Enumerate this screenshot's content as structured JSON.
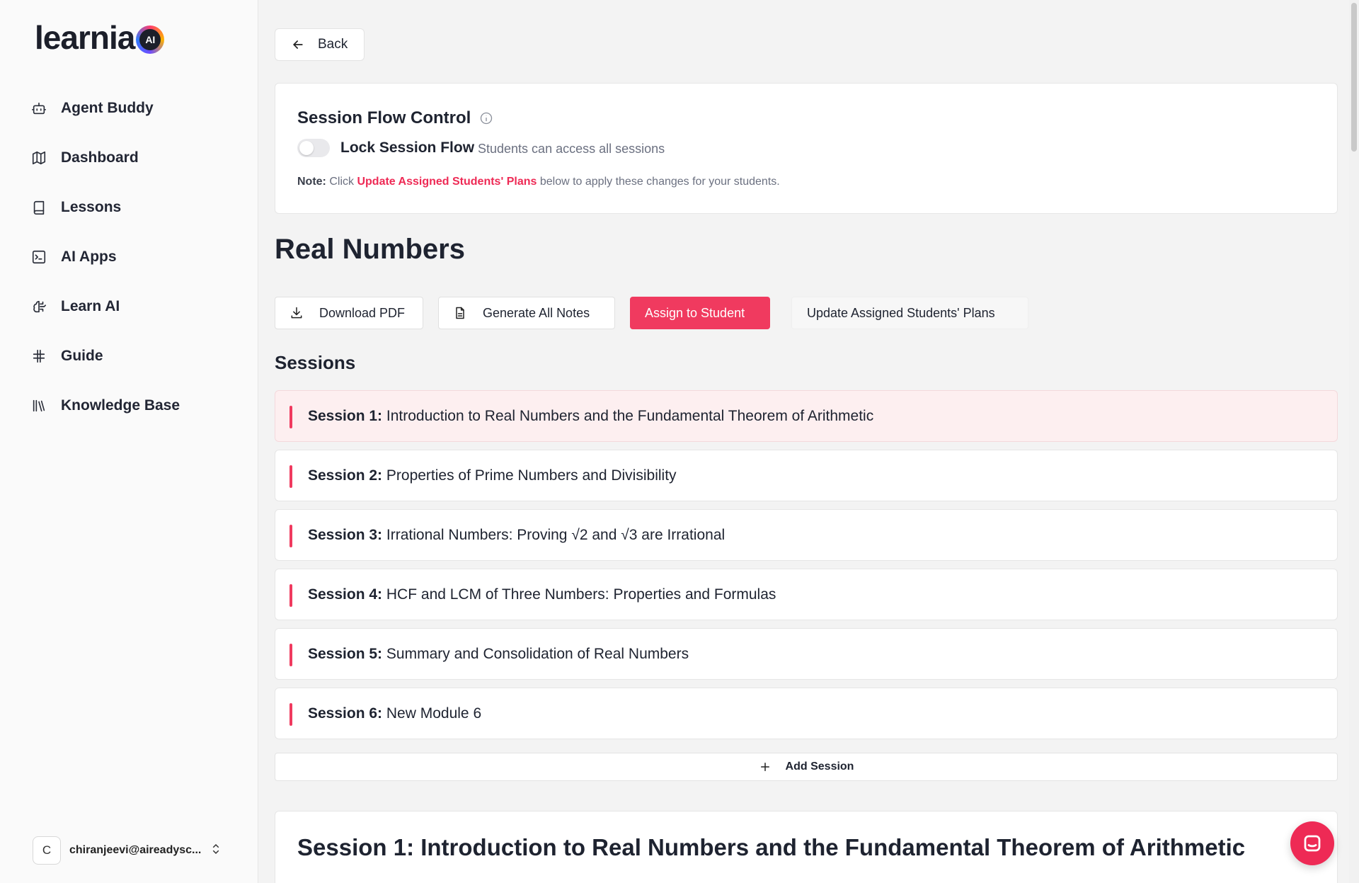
{
  "brand": {
    "name": "learnia",
    "badge": "AI"
  },
  "sidebar": {
    "items": [
      {
        "label": "Agent Buddy",
        "icon": "bot-icon"
      },
      {
        "label": "Dashboard",
        "icon": "map-icon"
      },
      {
        "label": "Lessons",
        "icon": "book-icon"
      },
      {
        "label": "AI Apps",
        "icon": "terminal-icon"
      },
      {
        "label": "Learn AI",
        "icon": "brain-icon"
      },
      {
        "label": "Guide",
        "icon": "hash-icon"
      },
      {
        "label": "Knowledge Base",
        "icon": "library-icon"
      }
    ],
    "user": {
      "initial": "C",
      "email": "chiranjeevi@aireadysc..."
    }
  },
  "header": {
    "back_label": "Back"
  },
  "flow_control": {
    "title": "Session Flow Control",
    "toggle_label": "Lock Session Flow",
    "toggle_on": false,
    "toggle_desc": "Students can access all sessions",
    "note_prefix": "Note:",
    "note_click": "Click",
    "note_highlight": "Update Assigned Students' Plans",
    "note_suffix": "below to apply these changes for your students."
  },
  "page": {
    "title": "Real Numbers"
  },
  "actions": {
    "download_pdf": "Download PDF",
    "generate_notes": "Generate All Notes",
    "assign_student": "Assign to Student",
    "update_plans": "Update Assigned Students' Plans"
  },
  "sessions": {
    "heading": "Sessions",
    "items": [
      {
        "num": "Session 1:",
        "title": "Introduction to Real Numbers and the Fundamental Theorem of Arithmetic"
      },
      {
        "num": "Session 2:",
        "title": "Properties of Prime Numbers and Divisibility"
      },
      {
        "num": "Session 3:",
        "title": "Irrational Numbers: Proving √2 and √3 are Irrational"
      },
      {
        "num": "Session 4:",
        "title": "HCF and LCM of Three Numbers: Properties and Formulas"
      },
      {
        "num": "Session 5:",
        "title": "Summary and Consolidation of Real Numbers"
      },
      {
        "num": "Session 6:",
        "title": "New Module 6"
      }
    ],
    "add_label": "Add Session"
  },
  "detail": {
    "title": "Session 1: Introduction to Real Numbers and the Fundamental Theorem of Arithmetic"
  },
  "colors": {
    "accent": "#f03a5f",
    "highlight_text": "#ee2a55",
    "active_row_bg": "#fdeff0"
  }
}
